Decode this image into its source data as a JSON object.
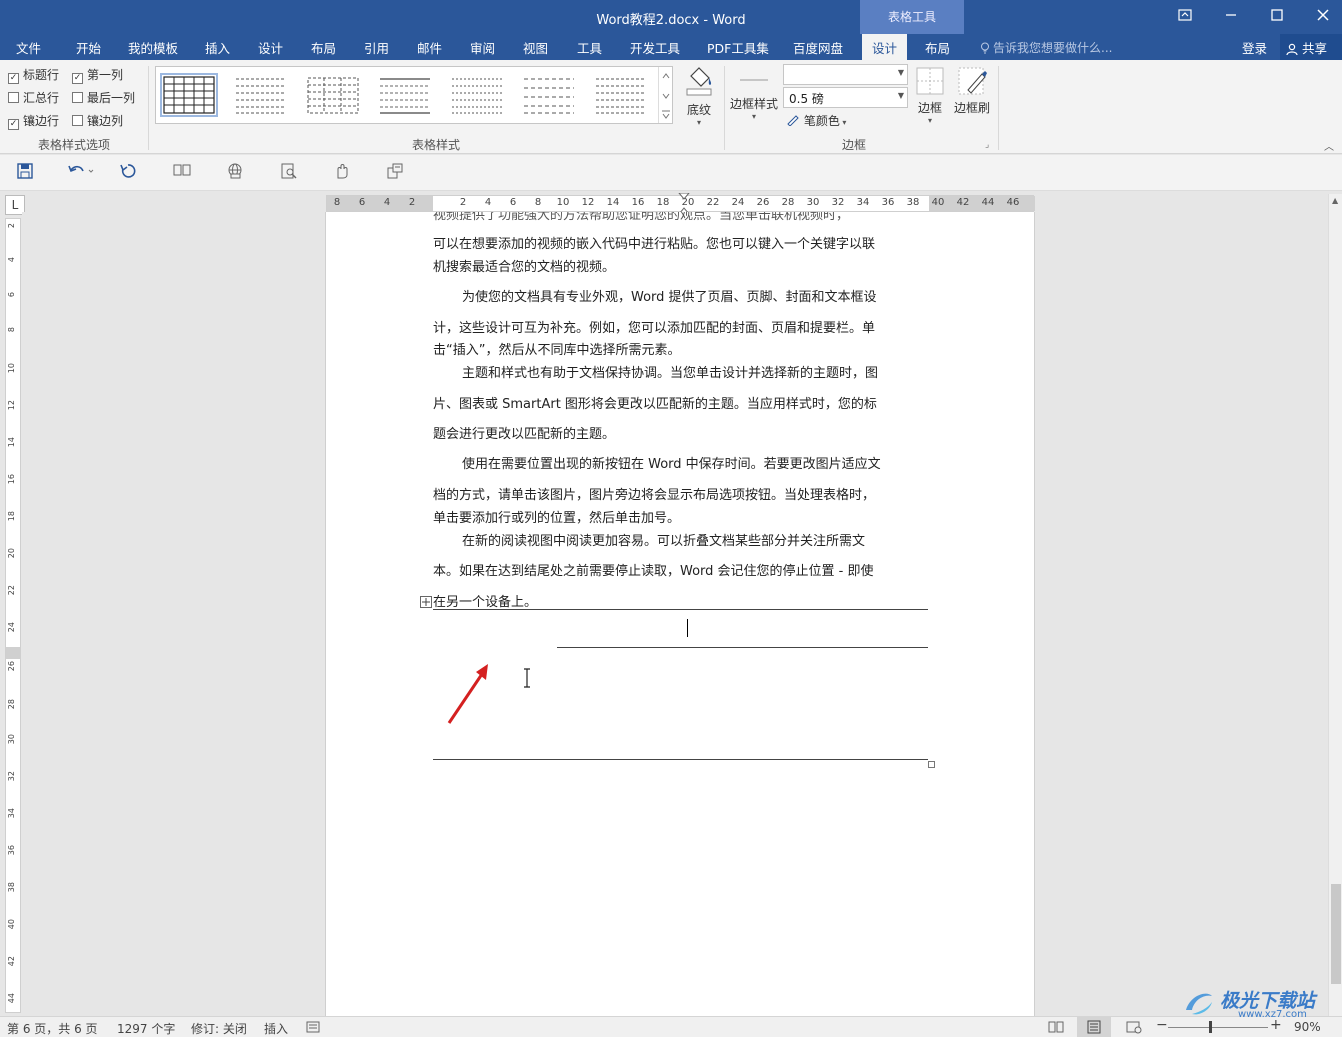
{
  "window": {
    "title": "Word教程2.docx - Word",
    "contextual_tab": "表格工具",
    "controls": [
      "restore-ribbon",
      "minimize",
      "maximize",
      "close"
    ]
  },
  "tabs": [
    "文件",
    "开始",
    "我的模板",
    "插入",
    "设计",
    "布局",
    "引用",
    "邮件",
    "审阅",
    "视图",
    "工具",
    "开发工具",
    "PDF工具集",
    "百度网盘",
    "设计",
    "布局"
  ],
  "active_tab": "设计",
  "tell_me": "告诉我您想要做什么...",
  "login": "登录",
  "share": "共享",
  "ribbon": {
    "style_options": {
      "checkboxes": [
        {
          "label": "标题行",
          "checked": true
        },
        {
          "label": "第一列",
          "checked": true
        },
        {
          "label": "汇总行",
          "checked": false
        },
        {
          "label": "最后一列",
          "checked": false
        },
        {
          "label": "镶边行",
          "checked": true
        },
        {
          "label": "镶边列",
          "checked": false
        }
      ],
      "group_label": "表格样式选项"
    },
    "table_styles": {
      "group_label": "表格样式"
    },
    "shading": "底纹",
    "borders": {
      "border_styles": "边框样式",
      "line_style_value": "",
      "line_weight_value": "0.5 磅",
      "pen_color": "笔颜色",
      "borders_btn": "边框",
      "border_painter": "边框刷",
      "group_label": "边框"
    }
  },
  "ruler": {
    "h_numbers": [
      "8",
      "6",
      "4",
      "2",
      "2",
      "4",
      "6",
      "8",
      "10",
      "12",
      "14",
      "16",
      "18",
      "20",
      "22",
      "24",
      "26",
      "28",
      "30",
      "32",
      "34",
      "36",
      "38",
      "40",
      "42",
      "44",
      "46"
    ],
    "v_numbers": [
      "2",
      "4",
      "6",
      "8",
      "10",
      "12",
      "14",
      "16",
      "18",
      "20",
      "22",
      "24",
      "26",
      "28",
      "30",
      "32",
      "34",
      "36",
      "38",
      "40",
      "42",
      "44"
    ],
    "corner": "L"
  },
  "document": {
    "lines": [
      "视频提供了功能强大的方法帮助您证明您的观点。当您单击联机视频时，",
      "可以在想要添加的视频的嵌入代码中进行粘贴。您也可以键入一个关键字以联",
      "机搜索最适合您的文档的视频。",
      "为使您的文档具有专业外观，Word 提供了页眉、页脚、封面和文本框设",
      "计，这些设计可互为补充。例如，您可以添加匹配的封面、页眉和提要栏。单",
      "击“插入”，然后从不同库中选择所需元素。",
      "主题和样式也有助于文档保持协调。当您单击设计并选择新的主题时，图",
      "片、图表或 SmartArt 图形将会更改以匹配新的主题。当应用样式时，您的标",
      "题会进行更改以匹配新的主题。",
      "使用在需要位置出现的新按钮在 Word 中保存时间。若要更改图片适应文",
      "档的方式，请单击该图片，图片旁边将会显示布局选项按钮。当处理表格时，",
      "单击要添加行或列的位置，然后单击加号。",
      "在新的阅读视图中阅读更加容易。可以折叠文档某些部分并关注所需文",
      "本。如果在达到结尾处之前需要停止读取，Word 会记住您的停止位置 - 即使",
      "在另一个设备上。"
    ]
  },
  "status": {
    "page": "第 6 页，共 6 页",
    "words": "1297 个字",
    "track": "修订: 关闭",
    "mode": "插入",
    "zoom": "90%"
  },
  "watermark": {
    "text": "极光下载站",
    "url": "www.xz7.com"
  },
  "colors": {
    "accent": "#2b579a",
    "arrow": "#d42020"
  }
}
